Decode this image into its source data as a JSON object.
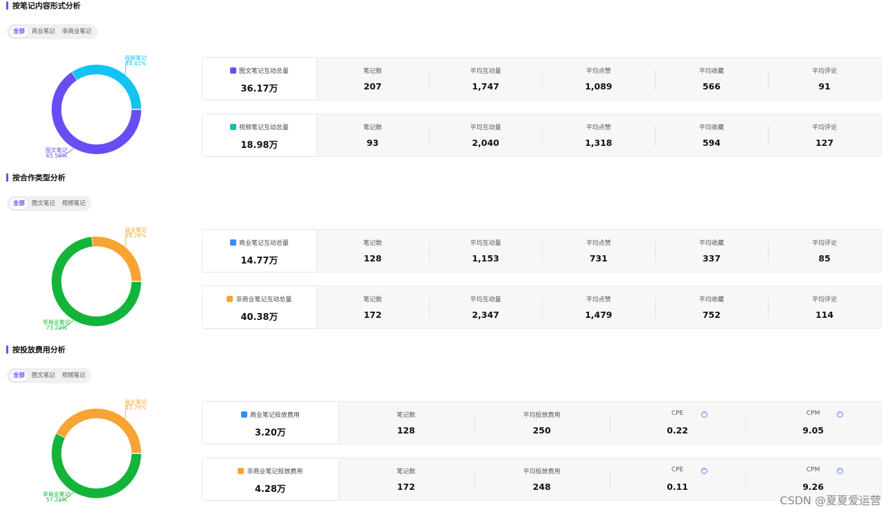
{
  "sections": [
    {
      "title": "按笔记内容形式分析",
      "tabs": [
        "全部",
        "商业笔记",
        "非商业笔记"
      ],
      "donut": {
        "slices": [
          {
            "name": "视频笔记",
            "pct": "34.41%",
            "value": 34.41,
            "color": "#12c3f4"
          },
          {
            "name": "图文笔记",
            "pct": "65.59%",
            "value": 65.59,
            "color": "#6a4cf5"
          }
        ]
      },
      "cards": [
        {
          "icon": "image-icon",
          "icon_color": "#6a4cf5",
          "total_label": "图文笔记互动总量",
          "total_value": "36.17万",
          "metrics": [
            {
              "label": "笔记数",
              "value": "207"
            },
            {
              "label": "平均互动量",
              "value": "1,747"
            },
            {
              "label": "平均点赞",
              "value": "1,089"
            },
            {
              "label": "平均收藏",
              "value": "566"
            },
            {
              "label": "平均评论",
              "value": "91"
            }
          ]
        },
        {
          "icon": "video-icon",
          "icon_color": "#1fb9a8",
          "total_label": "视频笔记互动总量",
          "total_value": "18.98万",
          "metrics": [
            {
              "label": "笔记数",
              "value": "93"
            },
            {
              "label": "平均互动量",
              "value": "2,040"
            },
            {
              "label": "平均点赞",
              "value": "1,318"
            },
            {
              "label": "平均收藏",
              "value": "594"
            },
            {
              "label": "平均评论",
              "value": "127"
            }
          ]
        }
      ]
    },
    {
      "title": "按合作类型分析",
      "tabs": [
        "全部",
        "图文笔记",
        "视频笔记"
      ],
      "donut": {
        "slices": [
          {
            "name": "商业笔记",
            "pct": "26.78%",
            "value": 26.78,
            "color": "#f7a434"
          },
          {
            "name": "非商业笔记",
            "pct": "73.22%",
            "value": 73.22,
            "color": "#12b43a"
          }
        ]
      },
      "cards": [
        {
          "icon": "commercial-note-icon",
          "icon_color": "#2f8df5",
          "total_label": "商业笔记互动总量",
          "total_value": "14.77万",
          "metrics": [
            {
              "label": "笔记数",
              "value": "128"
            },
            {
              "label": "平均互动量",
              "value": "1,153"
            },
            {
              "label": "平均点赞",
              "value": "731"
            },
            {
              "label": "平均收藏",
              "value": "337"
            },
            {
              "label": "平均评论",
              "value": "85"
            }
          ]
        },
        {
          "icon": "non-commercial-note-icon",
          "icon_color": "#f7a434",
          "total_label": "非商业笔记互动总量",
          "total_value": "40.38万",
          "metrics": [
            {
              "label": "笔记数",
              "value": "172"
            },
            {
              "label": "平均互动量",
              "value": "2,347"
            },
            {
              "label": "平均点赞",
              "value": "1,479"
            },
            {
              "label": "平均收藏",
              "value": "752"
            },
            {
              "label": "平均评论",
              "value": "114"
            }
          ]
        }
      ]
    },
    {
      "title": "按投放费用分析",
      "tabs": [
        "全部",
        "图文笔记",
        "视频笔记"
      ],
      "donut": {
        "slices": [
          {
            "name": "商业笔记",
            "pct": "42.79%",
            "value": 42.79,
            "color": "#f7a434"
          },
          {
            "name": "非商业笔记",
            "pct": "57.21%",
            "value": 57.21,
            "color": "#12b43a"
          }
        ]
      },
      "cards": [
        {
          "icon": "commercial-note-icon",
          "icon_color": "#2f8df5",
          "total_label": "商业笔记投放费用",
          "total_value": "3.20万",
          "metrics": [
            {
              "label": "笔记数",
              "value": "128"
            },
            {
              "label": "平均投放费用",
              "value": "250"
            },
            {
              "label": "CPE",
              "value": "0.22",
              "help": true
            },
            {
              "label": "CPM",
              "value": "9.05",
              "help": true
            }
          ]
        },
        {
          "icon": "non-commercial-note-icon",
          "icon_color": "#f7a434",
          "total_label": "非商业笔记投放费用",
          "total_value": "4.28万",
          "metrics": [
            {
              "label": "笔记数",
              "value": "172"
            },
            {
              "label": "平均投放费用",
              "value": "248"
            },
            {
              "label": "CPE",
              "value": "0.11",
              "help": true
            },
            {
              "label": "CPM",
              "value": "9.26",
              "help": true
            }
          ]
        }
      ]
    }
  ],
  "watermark": "CSDN @夏夏爱运营"
}
